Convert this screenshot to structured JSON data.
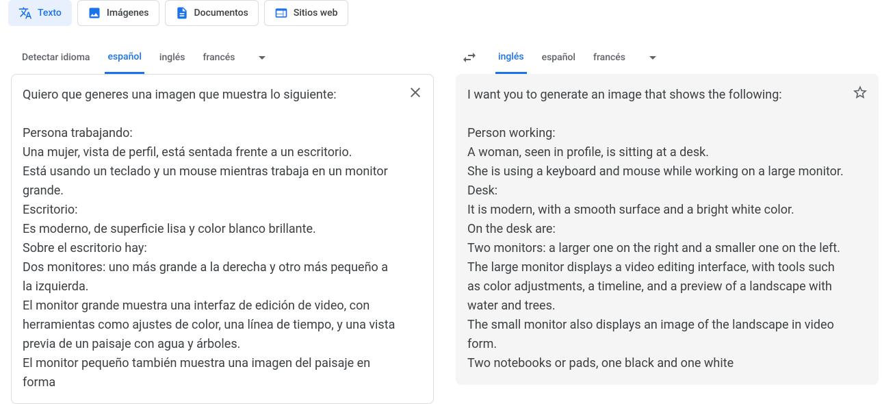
{
  "tabs": {
    "text": "Texto",
    "images": "Imágenes",
    "documents": "Documentos",
    "websites": "Sitios web"
  },
  "source": {
    "detect": "Detectar idioma",
    "lang1": "español",
    "lang2": "inglés",
    "lang3": "francés",
    "text": "Quiero que generes una imagen que muestra lo siguiente:\n\nPersona trabajando:\nUna mujer, vista de perfil, está sentada frente a un escritorio.\nEstá usando un teclado y un mouse mientras trabaja en un monitor grande.\nEscritorio:\nEs moderno, de superficie lisa y color blanco brillante.\nSobre el escritorio hay:\nDos monitores: uno más grande a la derecha y otro más pequeño a la izquierda.\nEl monitor grande muestra una interfaz de edición de video, con herramientas como ajustes de color, una línea de tiempo, y una vista previa de un paisaje con agua y árboles.\nEl monitor pequeño también muestra una imagen del paisaje en forma"
  },
  "target": {
    "lang1": "inglés",
    "lang2": "español",
    "lang3": "francés",
    "text": "I want you to generate an image that shows the following:\n\nPerson working:\nA woman, seen in profile, is sitting at a desk.\nShe is using a keyboard and mouse while working on a large monitor.\nDesk:\nIt is modern, with a smooth surface and a bright white color.\nOn the desk are:\nTwo monitors: a larger one on the right and a smaller one on the left.\nThe large monitor displays a video editing interface, with tools such as color adjustments, a timeline, and a preview of a landscape with water and trees.\nThe small monitor also displays an image of the landscape in video form.\nTwo notebooks or pads, one black and one white"
  }
}
